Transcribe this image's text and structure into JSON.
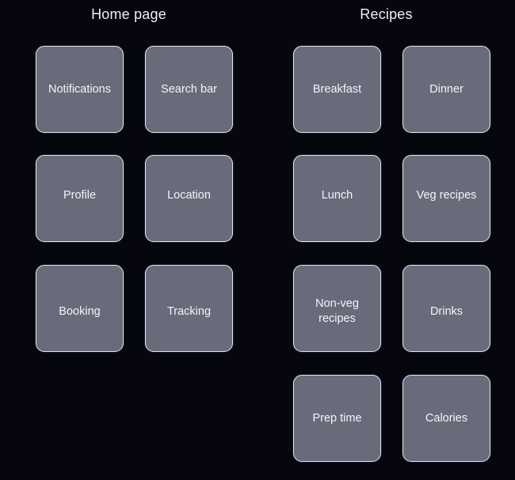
{
  "theme": {
    "background": "#05060e",
    "card_fill": "#686b7a",
    "card_border": "#e9e1f0",
    "title_color": "#f2ebf7",
    "label_color": "#f7f3fa"
  },
  "columns": [
    {
      "id": "home",
      "title": "Home page",
      "cards": [
        {
          "label": "Notifications",
          "row": 1,
          "slot": "a"
        },
        {
          "label": "Search bar",
          "row": 1,
          "slot": "b"
        },
        {
          "label": "Profile",
          "row": 2,
          "slot": "a"
        },
        {
          "label": "Location",
          "row": 2,
          "slot": "b"
        },
        {
          "label": "Booking",
          "row": 3,
          "slot": "a"
        },
        {
          "label": "Tracking",
          "row": 3,
          "slot": "b"
        }
      ]
    },
    {
      "id": "recipes",
      "title": "Recipes",
      "cards": [
        {
          "label": "Breakfast",
          "row": 1,
          "slot": "a"
        },
        {
          "label": "Dinner",
          "row": 1,
          "slot": "b"
        },
        {
          "label": "Lunch",
          "row": 2,
          "slot": "a"
        },
        {
          "label": "Veg recipes",
          "row": 2,
          "slot": "b"
        },
        {
          "label": "Non-veg\nrecipes",
          "row": 3,
          "slot": "a"
        },
        {
          "label": "Drinks",
          "row": 3,
          "slot": "b"
        },
        {
          "label": "Prep time",
          "row": 4,
          "slot": "a"
        },
        {
          "label": "Calories",
          "row": 4,
          "slot": "b"
        }
      ]
    }
  ]
}
